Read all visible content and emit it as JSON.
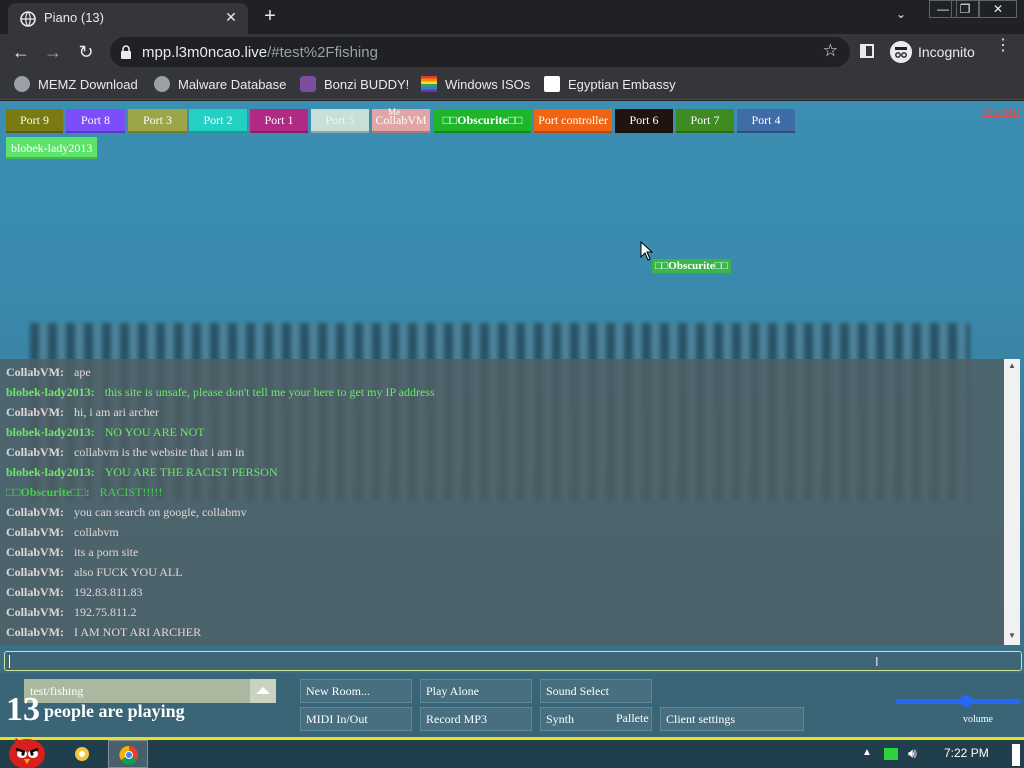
{
  "browser": {
    "tab_title": "Piano (13)",
    "tab_close": "✕",
    "new_tab": "+",
    "tab_search": "⌄",
    "window_controls": {
      "minimize": "—",
      "restore": "❐",
      "close": "✕"
    },
    "nav": {
      "back": "←",
      "forward": "→",
      "reload": "↻"
    },
    "url_host": "mpp.l3m0ncao.live",
    "url_path": "/#test%2Ffishing",
    "bookmark_star": "☆",
    "profile_label": "Incognito",
    "menu": "⋮",
    "bookmarks": [
      {
        "label": "MEMZ Download",
        "color": "#9aa0a6"
      },
      {
        "label": "Malware Database",
        "color": "#9aa0a6"
      },
      {
        "label": "Bonzi BUDDY!",
        "color": "#7a4ea0"
      },
      {
        "label": "Windows ISOs",
        "color": "#e53935"
      },
      {
        "label": "Egyptian Embassy",
        "color": "#ffffff"
      }
    ]
  },
  "ports": [
    {
      "label": "Port 9",
      "color": "#7a7a12"
    },
    {
      "label": "Port 8",
      "color": "#7b4dfb"
    },
    {
      "label": "Port 3",
      "color": "#9aa648"
    },
    {
      "label": "Port 2",
      "color": "#22d1c4"
    },
    {
      "label": "Port 1",
      "color": "#b02a84"
    },
    {
      "label": "Port 5",
      "color": "#c7ded9"
    },
    {
      "label": "CollabVM",
      "color": "#e1a5a5"
    },
    {
      "label": "□□Obscurite□□",
      "color": "#1fb52b"
    },
    {
      "label": "Port controller",
      "color": "#f06412"
    },
    {
      "label": "Port 6",
      "color": "#21130f"
    },
    {
      "label": "Port 7",
      "color": "#3e8b22"
    },
    {
      "label": "Port 4",
      "color": "#3f6ba6"
    }
  ],
  "me_tag": "Me",
  "help_link": "Fork Me!",
  "user_chip": "blobek-lady2013",
  "cursor_tag": "□□Obscurite□□",
  "chat": {
    "colors": {
      "CollabVM": "#e1c6c6",
      "blobek-lady2013": "#6de868",
      "obscurite": "#33c93c"
    },
    "messages": [
      {
        "name": "CollabVM:",
        "text": "ape",
        "color": "#e4d6d6"
      },
      {
        "name": "blobek-lady2013:",
        "text": "this site is unsafe, please don't tell me your here to get my IP address",
        "color": "#6fe86a"
      },
      {
        "name": "CollabVM:",
        "text": "hi, i am ari archer",
        "color": "#e4d6d6"
      },
      {
        "name": "blobek-lady2013:",
        "text": "NO YOU ARE NOT",
        "color": "#6fe86a"
      },
      {
        "name": "CollabVM:",
        "text": "collabvm is the website that i am in",
        "color": "#e4d6d6"
      },
      {
        "name": "blobek-lady2013:",
        "text": "YOU ARE THE RACIST PERSON",
        "color": "#6fe86a"
      },
      {
        "name": "□□Obscurite□□:",
        "text": "RACIST!!!!!",
        "color": "#3fd347"
      },
      {
        "name": "CollabVM:",
        "text": "you can search on google, collabmv",
        "color": "#e4d6d6"
      },
      {
        "name": "CollabVM:",
        "text": "collabvm",
        "color": "#e4d6d6"
      },
      {
        "name": "CollabVM:",
        "text": "its a porn site",
        "color": "#e4d6d6"
      },
      {
        "name": "CollabVM:",
        "text": "also FUCK YOU ALL",
        "color": "#e4d6d6"
      },
      {
        "name": "CollabVM:",
        "text": "192.83.811.83",
        "color": "#e4d6d6"
      },
      {
        "name": "CollabVM:",
        "text": "192.75.811.2",
        "color": "#e4d6d6"
      },
      {
        "name": "CollabVM:",
        "text": "I AM NOT ARI ARCHER",
        "color": "#e4d6d6"
      }
    ],
    "input_value": ""
  },
  "room": {
    "name": "test/fishing",
    "people_count": "13",
    "people_label": "people are playing"
  },
  "buttons": {
    "new_room": "New Room...",
    "play_alone": "Play Alone",
    "sound_select": "Sound Select",
    "midi": "MIDI In/Out",
    "record": "Record MP3",
    "synth": "Synth",
    "pallete": "Pallete",
    "client_settings": "Client settings"
  },
  "volume": {
    "label": "volume",
    "level": 0.57
  },
  "taskbar": {
    "time": "7:22 PM",
    "tray_up": "▲"
  }
}
